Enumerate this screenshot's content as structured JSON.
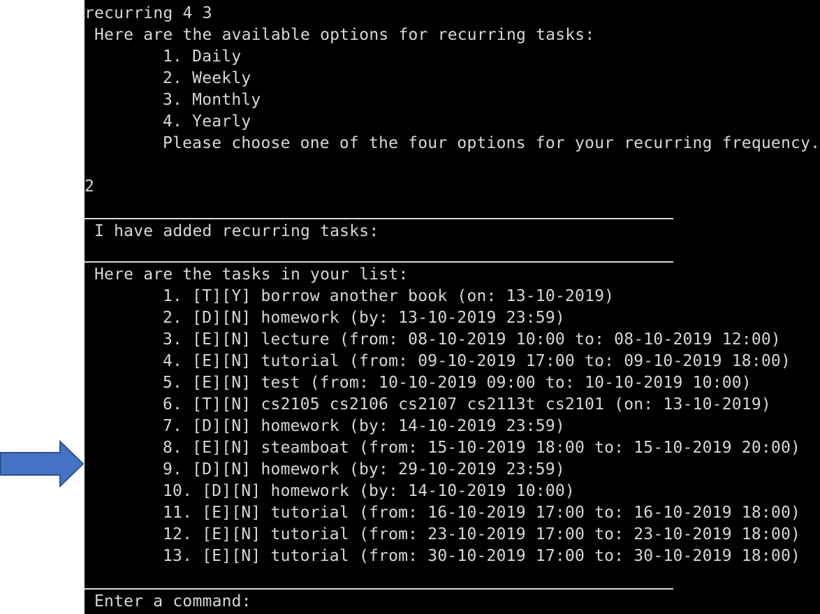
{
  "terminal": {
    "command": "recurring 4 3",
    "options_header": "Here are the available options for recurring tasks:",
    "options": [
      "1. Daily",
      "2. Weekly",
      "3. Monthly",
      "4. Yearly"
    ],
    "options_prompt": "Please choose one of the four options for your recurring frequency.",
    "user_choice": "2",
    "added_message": "I have added recurring tasks:",
    "list_header": "Here are the tasks in your list:",
    "tasks": [
      "1. [T][Y] borrow another book (on: 13-10-2019)",
      "2. [D][N] homework (by: 13-10-2019 23:59)",
      "3. [E][N] lecture (from: 08-10-2019 10:00 to: 08-10-2019 12:00)",
      "4. [E][N] tutorial (from: 09-10-2019 17:00 to: 09-10-2019 18:00)",
      "5. [E][N] test (from: 10-10-2019 09:00 to: 10-10-2019 10:00)",
      "6. [T][N] cs2105 cs2106 cs2107 cs2113t cs2101 (on: 13-10-2019)",
      "7. [D][N] homework (by: 14-10-2019 23:59)",
      "8. [E][N] steamboat (from: 15-10-2019 18:00 to: 15-10-2019 20:00)",
      "9. [D][N] homework (by: 29-10-2019 23:59)",
      "10. [D][N] homework (by: 14-10-2019 10:00)",
      "11. [E][N] tutorial (from: 16-10-2019 17:00 to: 16-10-2019 18:00)",
      "12. [E][N] tutorial (from: 23-10-2019 17:00 to: 23-10-2019 18:00)",
      "13. [E][N] tutorial (from: 30-10-2019 17:00 to: 30-10-2019 18:00)"
    ],
    "input_prompt": "Enter a command:"
  },
  "colors": {
    "terminal_background": "#000000",
    "terminal_text": "#d7d7d7",
    "arrow_fill": "#4472c4",
    "arrow_stroke": "#2f528f"
  },
  "icons": {
    "arrow": "right-arrow-icon"
  }
}
